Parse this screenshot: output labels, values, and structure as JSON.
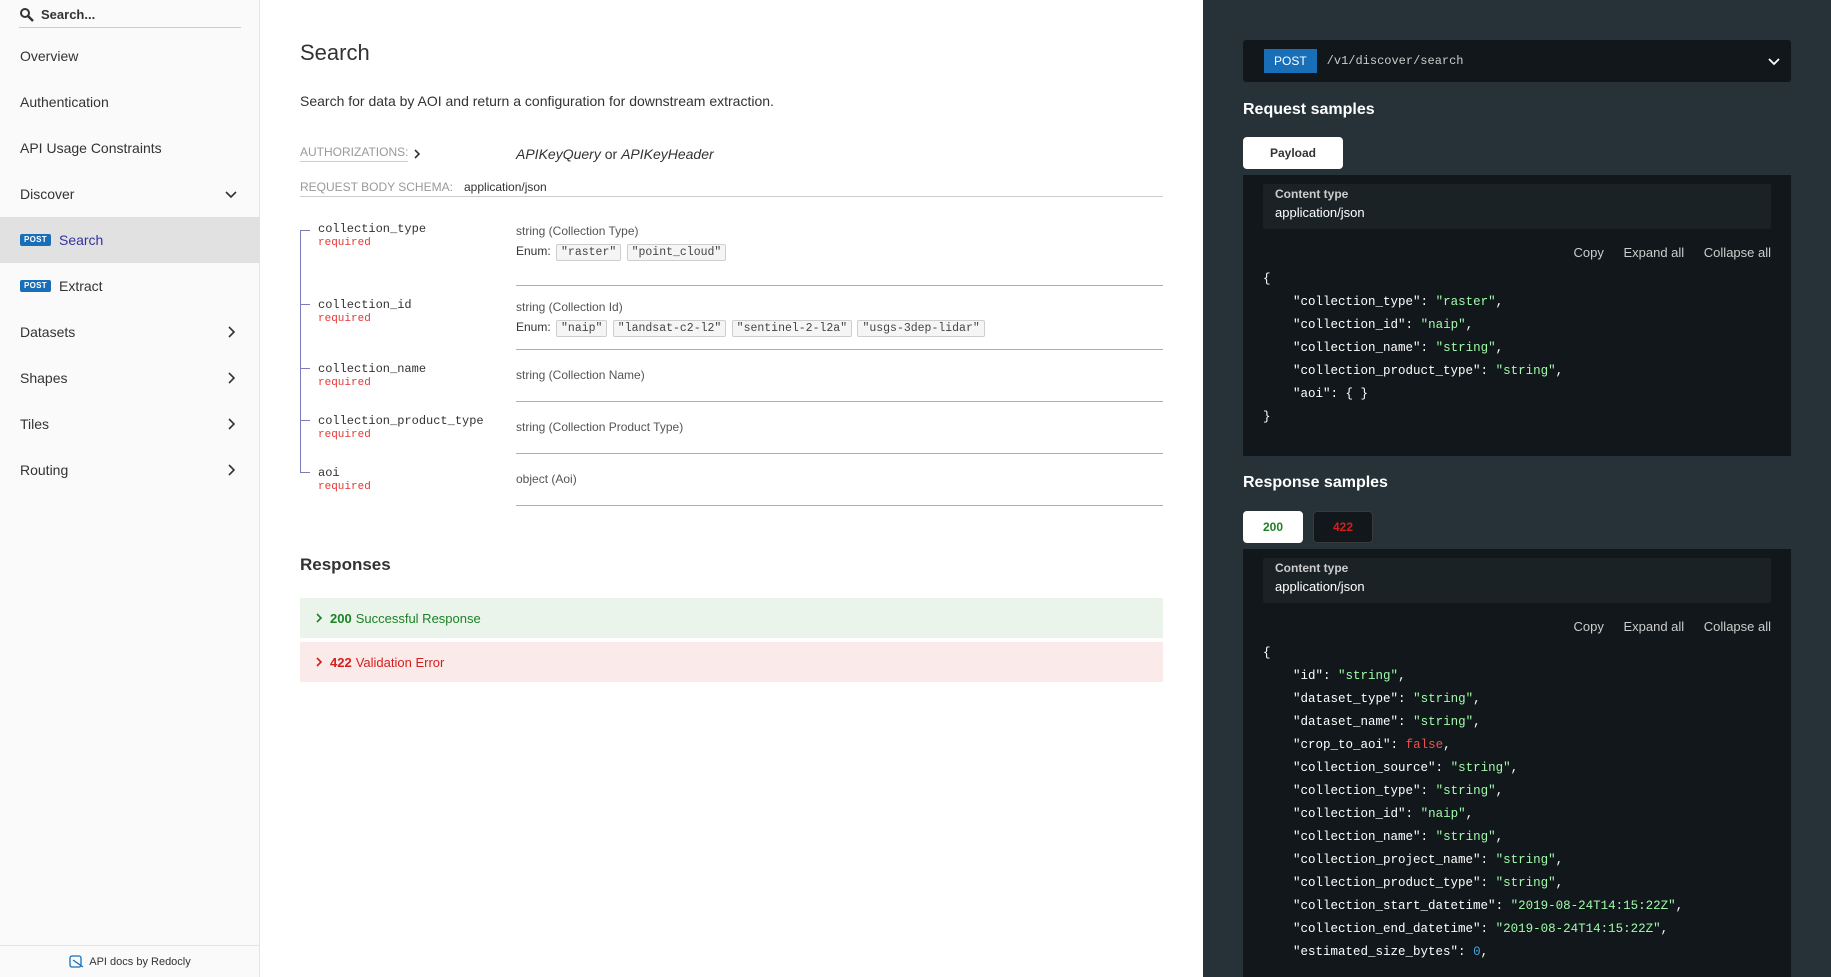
{
  "sidebar": {
    "search_placeholder": "Search...",
    "items": [
      {
        "label": "Overview"
      },
      {
        "label": "Authentication"
      },
      {
        "label": "API Usage Constraints"
      },
      {
        "label": "Discover"
      },
      {
        "label": "Search",
        "badge": "POST"
      },
      {
        "label": "Extract",
        "badge": "POST"
      },
      {
        "label": "Datasets"
      },
      {
        "label": "Shapes"
      },
      {
        "label": "Tiles"
      },
      {
        "label": "Routing"
      }
    ],
    "footer": "API docs by Redocly"
  },
  "main": {
    "title": "Search",
    "description": "Search for data by AOI and return a configuration for downstream extraction.",
    "auth_label": "AUTHORIZATIONS:",
    "auth_a": "APIKeyQuery",
    "auth_or": " or ",
    "auth_b": "APIKeyHeader",
    "schema_label": "REQUEST BODY SCHEMA:",
    "schema_value": "application/json",
    "enum_label": "Enum:",
    "props": [
      {
        "name": "collection_type",
        "req": "required",
        "type": "string (Collection Type)",
        "enum": [
          "\"raster\"",
          "\"point_cloud\""
        ]
      },
      {
        "name": "collection_id",
        "req": "required",
        "type": "string (Collection Id)",
        "enum": [
          "\"naip\"",
          "\"landsat-c2-l2\"",
          "\"sentinel-2-l2a\"",
          "\"usgs-3dep-lidar\""
        ]
      },
      {
        "name": "collection_name",
        "req": "required",
        "type": "string (Collection Name)"
      },
      {
        "name": "collection_product_type",
        "req": "required",
        "type": "string (Collection Product Type)"
      },
      {
        "name": "aoi",
        "req": "required",
        "type": "object (Aoi)"
      }
    ],
    "responses_title": "Responses",
    "responses": [
      {
        "code": "200",
        "text": "Successful Response"
      },
      {
        "code": "422",
        "text": "Validation Error"
      }
    ]
  },
  "right": {
    "method": "POST",
    "path": "/v1/discover/search",
    "request_title": "Request samples",
    "payload_tab": "Payload",
    "content_type_label": "Content type",
    "content_type_value": "application/json",
    "copy": "Copy",
    "expand": "Expand all",
    "collapse": "Collapse all",
    "response_title": "Response samples",
    "tab_200": "200",
    "tab_422": "422",
    "colors": {
      "ok": "#1d8127",
      "err": "#d41f1c",
      "badge": "#186fb8"
    }
  }
}
